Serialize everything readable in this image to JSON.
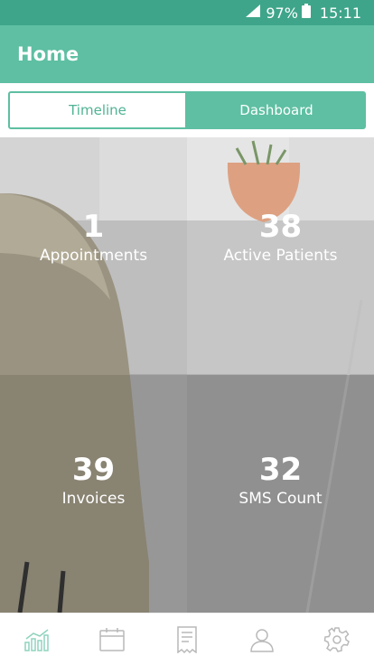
{
  "status_bar": {
    "battery": "97%",
    "time": "15:11"
  },
  "app_bar": {
    "title": "Home"
  },
  "tabs": [
    {
      "label": "Timeline",
      "selected": false
    },
    {
      "label": "Dashboard",
      "selected": true
    }
  ],
  "stats": [
    {
      "value": "1",
      "label": "Appointments"
    },
    {
      "value": "38",
      "label": "Active Patients"
    },
    {
      "value": "39",
      "label": "Invoices"
    },
    {
      "value": "32",
      "label": "SMS Count"
    }
  ],
  "bottom_nav": [
    {
      "icon": "chart-icon",
      "active": true
    },
    {
      "icon": "calendar-icon",
      "active": false
    },
    {
      "icon": "invoice-icon",
      "active": false
    },
    {
      "icon": "patients-icon",
      "active": false
    },
    {
      "icon": "gear-icon",
      "active": false
    }
  ],
  "colors": {
    "primary": "#5ebfa2",
    "status_bar": "#3fa58a",
    "nav_inactive": "#b9b9b9",
    "nav_active": "#8fd3bf"
  }
}
